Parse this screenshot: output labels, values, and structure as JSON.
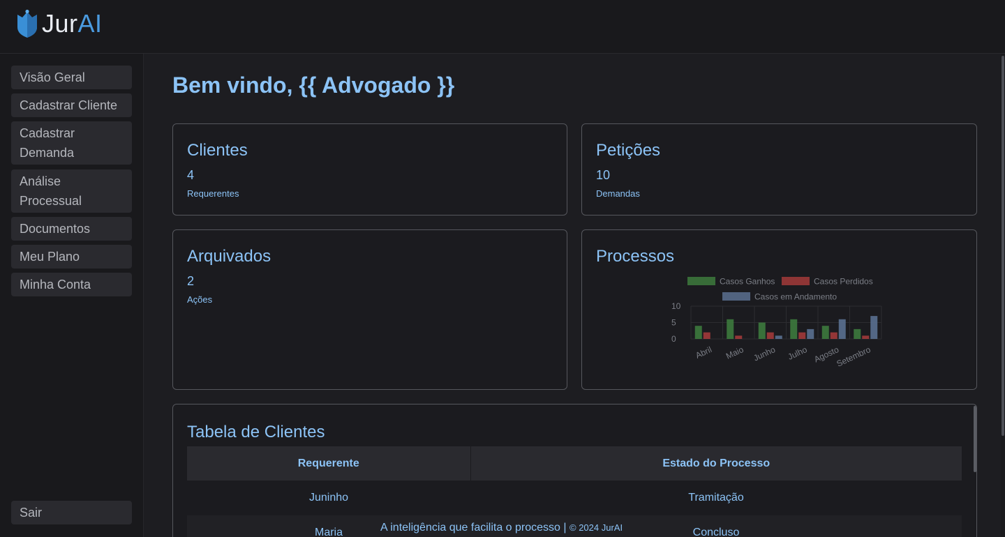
{
  "app": {
    "logo_text_main": "Jur",
    "logo_text_accent": "AI",
    "brand_color": "#4b9be0",
    "accent_text_color": "#8cc3f6"
  },
  "sidebar": {
    "items": [
      {
        "label": "Visão Geral"
      },
      {
        "label": "Cadastrar Cliente"
      },
      {
        "label": "Cadastrar Demanda"
      },
      {
        "label": "Análise Processual"
      },
      {
        "label": "Documentos"
      },
      {
        "label": "Meu Plano"
      },
      {
        "label": "Minha Conta"
      }
    ],
    "logout_label": "Sair"
  },
  "main": {
    "welcome": "Bem vindo, {{ Advogado }}",
    "cards": [
      {
        "title": "Clientes",
        "value": "4",
        "label": "Requerentes"
      },
      {
        "title": "Petições",
        "value": "10",
        "label": "Demandas"
      },
      {
        "title": "Arquivados",
        "value": "2",
        "label": "Ações"
      },
      {
        "title": "Processos"
      }
    ]
  },
  "chart_data": {
    "type": "bar",
    "categories": [
      "Abril",
      "Maio",
      "Junho",
      "Julho",
      "Agosto",
      "Setembro"
    ],
    "series": [
      {
        "name": "Casos Ganhos",
        "values": [
          4,
          6,
          5,
          6,
          4,
          3
        ],
        "color": "#3d7a3d"
      },
      {
        "name": "Casos Perdidos",
        "values": [
          2,
          1,
          2,
          2,
          2,
          1
        ],
        "color": "#a23a3a"
      },
      {
        "name": "Casos em Andamento",
        "values": [
          0,
          0,
          1,
          3,
          6,
          7
        ],
        "color": "#5a7090"
      }
    ],
    "y_ticks": [
      "0",
      "5",
      "10"
    ],
    "ylim": [
      0,
      10
    ],
    "legend": "top",
    "grid": true
  },
  "table": {
    "title": "Tabela de Clientes",
    "headers": [
      "Requerente",
      "Estado do Processo"
    ],
    "rows": [
      [
        "Juninho",
        "Tramitação"
      ],
      [
        "Maria",
        "Concluso"
      ]
    ]
  },
  "footer": {
    "tagline": "A inteligência que facilita o processo |",
    "copyright": "© 2024 JurAI"
  }
}
